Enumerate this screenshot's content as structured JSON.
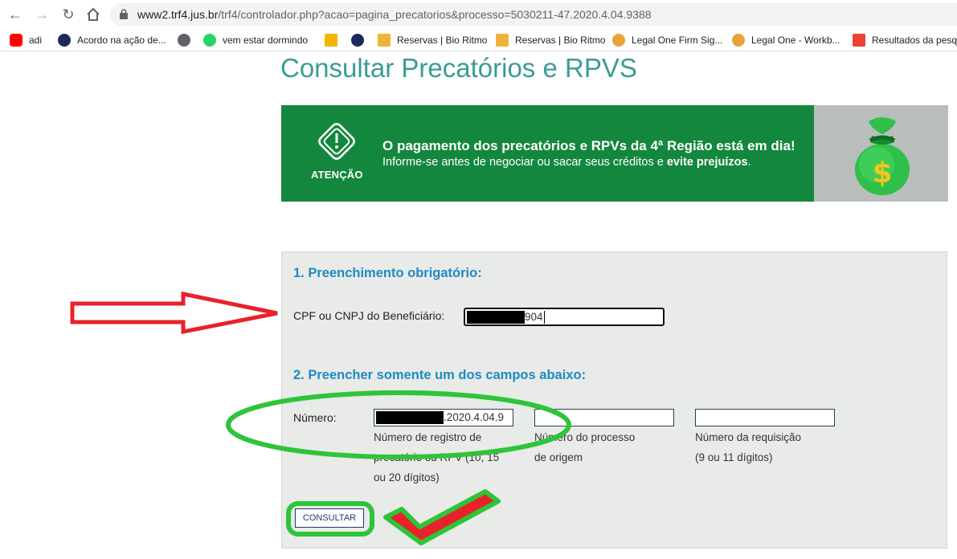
{
  "browser": {
    "url_host": "www2.trf4.jus.br",
    "url_path": "/trf4/controlador.php?acao=pagina_precatorios&processo=5030211-47.2020.4.04.9388",
    "bookmarks": [
      {
        "label": "adi",
        "icon": "youtube-icon",
        "color": "#ff0000"
      },
      {
        "label": "Acordo na ação de...",
        "icon": "court-seal-icon",
        "color": "#1b2a5c"
      },
      {
        "label": "",
        "icon": "globe-icon",
        "color": "#5f6368"
      },
      {
        "label": "vem estar dormindo",
        "icon": "whatsapp-icon",
        "color": "#25d366"
      },
      {
        "label": "",
        "icon": "drive-icon",
        "color": "#f4b400"
      },
      {
        "label": "",
        "icon": "court-seal-icon",
        "color": "#1b2a5c"
      },
      {
        "label": "Reservas | Bio Ritmo",
        "icon": "fit-icon",
        "color": "#f0b33a"
      },
      {
        "label": "Reservas | Bio Ritmo",
        "icon": "fit-icon",
        "color": "#f0b33a"
      },
      {
        "label": "Legal One Firm Sig...",
        "icon": "legal-one-icon",
        "color": "#e8a43a"
      },
      {
        "label": "Legal One - Workb...",
        "icon": "legal-one-icon",
        "color": "#e8a43a"
      },
      {
        "label": "Resultados da pesq...",
        "icon": "gmail-icon",
        "color": "#ea4335"
      }
    ]
  },
  "page": {
    "title": "Consultar Precatórios e RPVS",
    "banner": {
      "alert_label": "ATENÇÃO",
      "line1": "O pagamento dos precatórios e RPVs da 4ª Região está em dia!",
      "line2_prefix": "Informe-se antes de negociar ou sacar seus créditos e ",
      "line2_bold": "evite prejuízos",
      "line2_suffix": "."
    },
    "form": {
      "section1_title": "1. Preenchimento obrigatório:",
      "cpf_label": "CPF ou CNPJ do Beneficiário:",
      "cpf_value_visible": "904",
      "section2_title": "2. Preencher somente um dos campos abaixo:",
      "numero_label": "Número:",
      "numero_value_visible": ".2020.4.04.9",
      "hint_registro": [
        "Número de registro de",
        "precatório ou RPV (10, 15",
        "ou 20 dígitos)"
      ],
      "hint_processo": [
        "Número do processo",
        "de origem"
      ],
      "hint_requisicao": [
        "Número da requisição",
        "(9 ou 11 dígitos)"
      ],
      "submit_label": "CONSULTAR"
    }
  },
  "colors": {
    "title": "#3a9c94",
    "banner_green": "#14873e",
    "section_title": "#1f8ac3",
    "annotation_red": "#e8222a",
    "annotation_green": "#2ec43a"
  }
}
